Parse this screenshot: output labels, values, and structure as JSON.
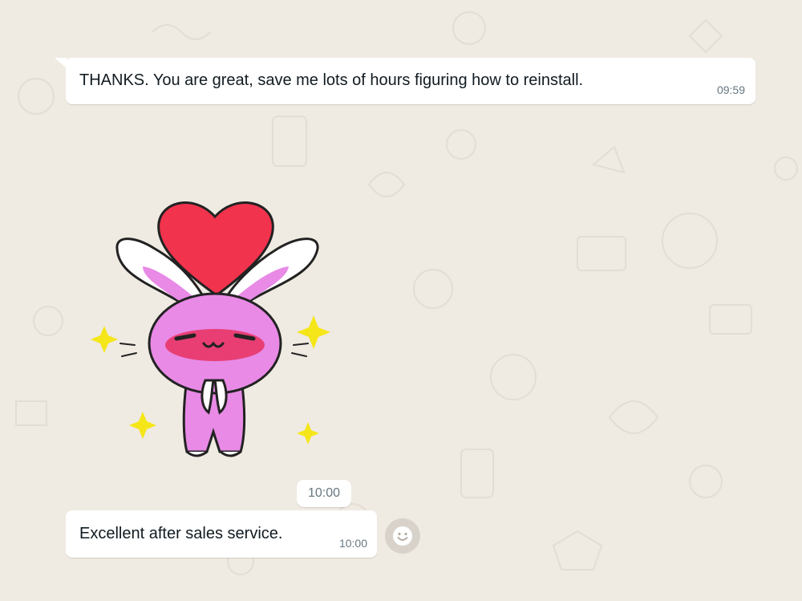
{
  "messages": [
    {
      "text": "THANKS. You are great, save me lots of hours figuring how to reinstall.",
      "time": "09:59"
    },
    {
      "sticker": "pink-bunny-heart-sticker",
      "time": "10:00"
    },
    {
      "text": "Excellent after sales service.",
      "time": "10:00"
    }
  ],
  "colors": {
    "chat_background": "#efeae2",
    "bubble": "#ffffff",
    "meta_text": "#667781"
  },
  "icons": {
    "reaction": "smiley-icon"
  }
}
